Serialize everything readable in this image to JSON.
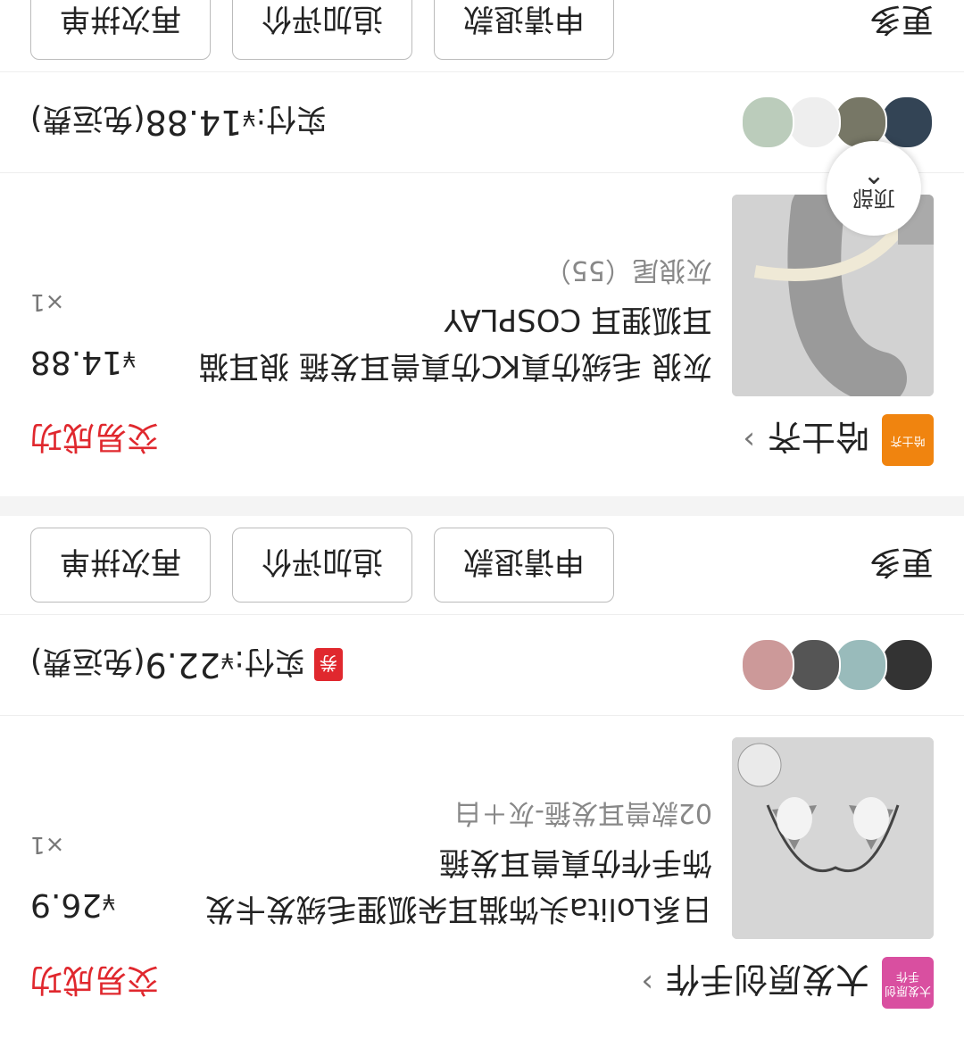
{
  "orders": [
    {
      "shop_logo_text": "大发原创手作",
      "shop_logo_color": "#d94fa0",
      "shop_name": "大发原创手作",
      "status": "交易成功",
      "item_title": "日系Lolita头饰猫耳朵狐狸毛绒发卡发饰手作仿真兽耳发箍",
      "item_spec": "02款兽耳发箍-灰＋白",
      "price_symbol": "¥",
      "price": "26.9",
      "qty": "×1",
      "coupon_label": "券",
      "paid_label": "实付:",
      "paid_symbol": "¥",
      "paid_amount": "22.9",
      "shipping_note": "(免运费)",
      "more_label": "更多",
      "buttons": [
        "申请退款",
        "追加评价",
        "再次拼单"
      ]
    },
    {
      "shop_logo_text": "哈士齐",
      "shop_logo_color": "#f0840f",
      "shop_name": "哈士齐",
      "status": "交易成功",
      "item_title": "灰狼 毛绒仿真KC仿真兽耳发箍 狼耳猫耳狐狸耳 COSPLAY",
      "item_spec": "灰狼尾（55）",
      "price_symbol": "¥",
      "price": "14.88",
      "qty": "×1",
      "paid_label": "实付:",
      "paid_symbol": "¥",
      "paid_amount": "14.88",
      "shipping_note": "(免运费)",
      "more_label": "更多",
      "buttons": [
        "申请退款",
        "追加评价",
        "再次拼单"
      ]
    }
  ],
  "back_to_top_label": "顶部"
}
